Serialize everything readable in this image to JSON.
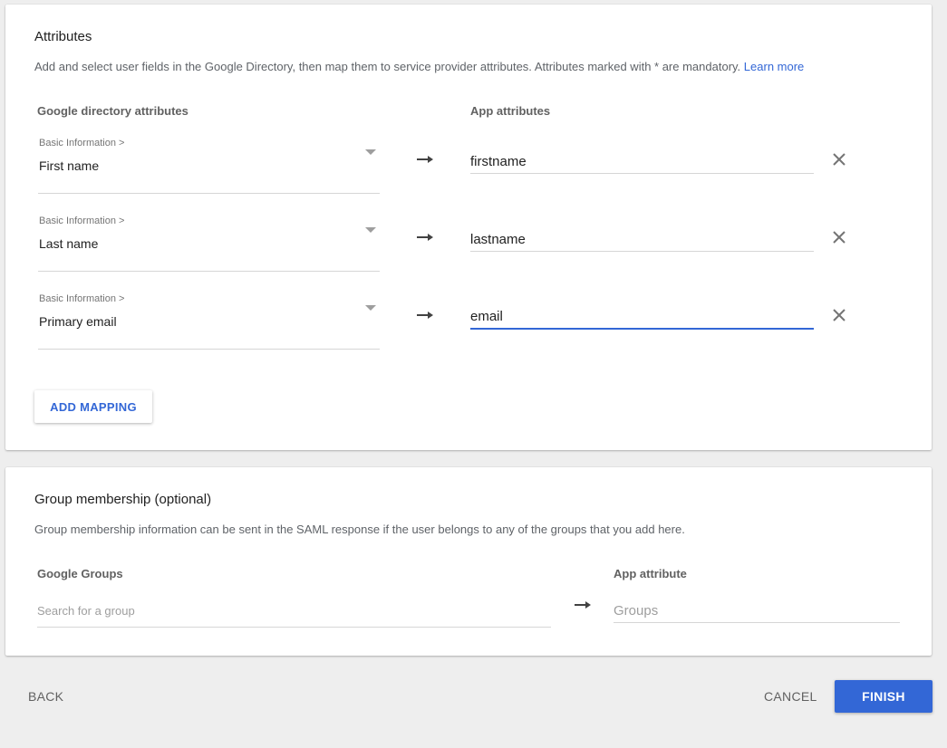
{
  "attributes": {
    "title": "Attributes",
    "description": "Add and select user fields in the Google Directory, then map them to service provider attributes. Attributes marked with * are mandatory.",
    "learn_more": "Learn more",
    "col_directory": "Google directory attributes",
    "col_app": "App attributes",
    "mappings": [
      {
        "category": "Basic Information >",
        "field": "First name",
        "app_attribute": "firstname"
      },
      {
        "category": "Basic Information >",
        "field": "Last name",
        "app_attribute": "lastname"
      },
      {
        "category": "Basic Information >",
        "field": "Primary email",
        "app_attribute": "email"
      }
    ],
    "add_mapping_label": "ADD MAPPING"
  },
  "groups": {
    "title": "Group membership (optional)",
    "description": "Group membership information can be sent in the SAML response if the user belongs to any of the groups that you add here.",
    "col_groups": "Google Groups",
    "col_app": "App attribute",
    "search_placeholder": "Search for a group",
    "app_placeholder": "Groups"
  },
  "footer": {
    "back_label": "BACK",
    "cancel_label": "CANCEL",
    "finish_label": "FINISH"
  },
  "colors": {
    "accent": "#3367d6",
    "background": "#eeeeee",
    "card": "#ffffff"
  },
  "icons": {
    "arrow": "arrow-right-icon",
    "remove": "close-icon",
    "dropdown": "caret-down-icon"
  }
}
